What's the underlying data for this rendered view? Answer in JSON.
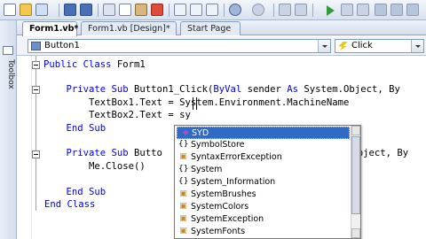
{
  "tabs": [
    {
      "label": "Form1.vb*",
      "active": true
    },
    {
      "label": "Form1.vb [Design]*",
      "active": false
    },
    {
      "label": "Start Page",
      "active": false
    }
  ],
  "toolbox": {
    "label": "Toolbox"
  },
  "nav": {
    "object_combo": "Button1",
    "method_combo": "Click"
  },
  "code_lines": {
    "l1a": "Public Class",
    "l1b": " Form1",
    "l2a": "    Private Sub",
    "l2b": " Button1_Click(",
    "l2c": "ByVal",
    "l2d": " sender ",
    "l2e": "As",
    "l2f": " System.Object, By",
    "l3": "        TextBox1.Text = System.Environment.MachineName",
    "l4": "        TextBox2.Text = sy",
    "l5a": "    End Sub",
    "l6a": "    Private Sub",
    "l6b": " Butto",
    "l6c": ".Object, By",
    "l7": "        Me.Close()",
    "l8a": "    End Sub",
    "l9a": "End Class"
  },
  "completion": {
    "items": [
      {
        "label": "SYD",
        "icon": "method-icon",
        "selected": true
      },
      {
        "label": "SymbolStore",
        "icon": "namespace-icon",
        "selected": false
      },
      {
        "label": "SyntaxErrorException",
        "icon": "class-icon",
        "selected": false
      },
      {
        "label": "System",
        "icon": "namespace-icon",
        "selected": false
      },
      {
        "label": "System_Information",
        "icon": "namespace-icon",
        "selected": false
      },
      {
        "label": "SystemBrushes",
        "icon": "class-icon",
        "selected": false
      },
      {
        "label": "SystemColors",
        "icon": "class-icon",
        "selected": false
      },
      {
        "label": "SystemException",
        "icon": "class-icon",
        "selected": false
      },
      {
        "label": "SystemFonts",
        "icon": "class-icon",
        "selected": false
      }
    ]
  },
  "colors": {
    "keyword": "#0000ff",
    "selection": "#316ac5"
  }
}
